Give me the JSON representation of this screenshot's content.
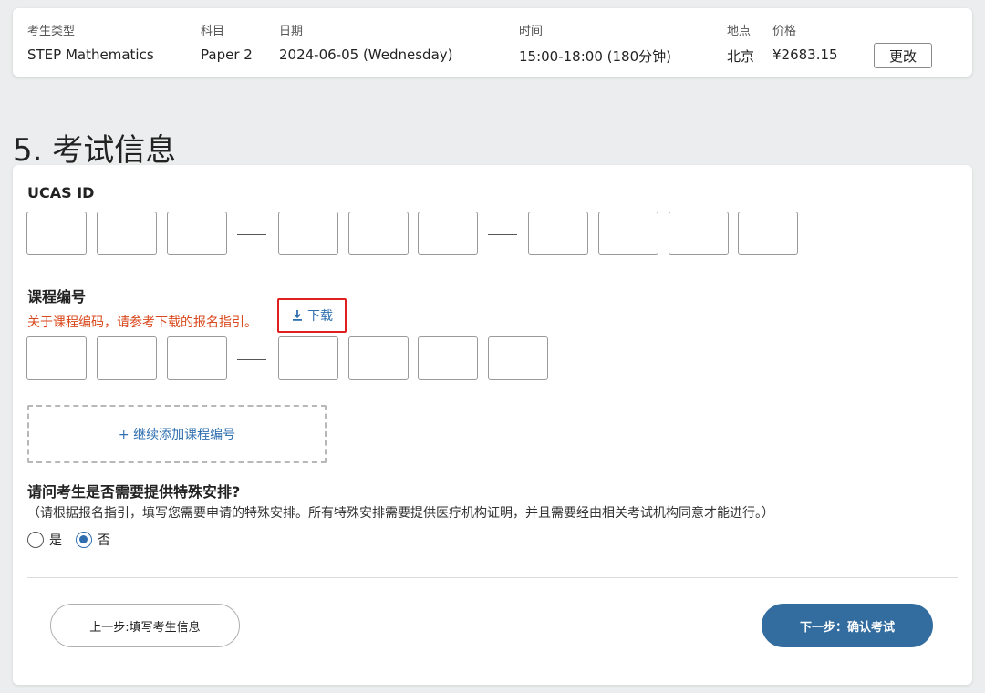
{
  "summary": {
    "headers": {
      "candidate_type": "考生类型",
      "subject": "科目",
      "date": "日期",
      "time": "时间",
      "location": "地点",
      "price": "价格"
    },
    "values": {
      "candidate_type": "STEP Mathematics",
      "subject": "Paper 2",
      "date": "2024-06-05 (Wednesday)",
      "time": "15:00-18:00 (180分钟)",
      "location": "北京",
      "price": "¥2683.15"
    },
    "change_label": "更改"
  },
  "section_title": "5. 考试信息",
  "ucas": {
    "label": "UCAS ID"
  },
  "course": {
    "label": "课程编号",
    "hint": "关于课程编码，请参考下载的报名指引。",
    "download_label": "下载",
    "add_label": "+ 继续添加课程编号"
  },
  "special": {
    "question": "请问考生是否需要提供特殊安排?",
    "note": "（请根据报名指引，填写您需要申请的特殊安排。所有特殊安排需要提供医疗机构证明，并且需要经由相关考试机构同意才能进行。）",
    "yes_label": "是",
    "no_label": "否",
    "selected": "否"
  },
  "nav": {
    "prev_label": "上一步:填写考生信息",
    "next_label": "下一步：确认考试"
  },
  "colors": {
    "accent": "#336d9f",
    "link": "#2f6fb0",
    "hint": "#d9491d",
    "highlight_border": "#e01f1f"
  }
}
